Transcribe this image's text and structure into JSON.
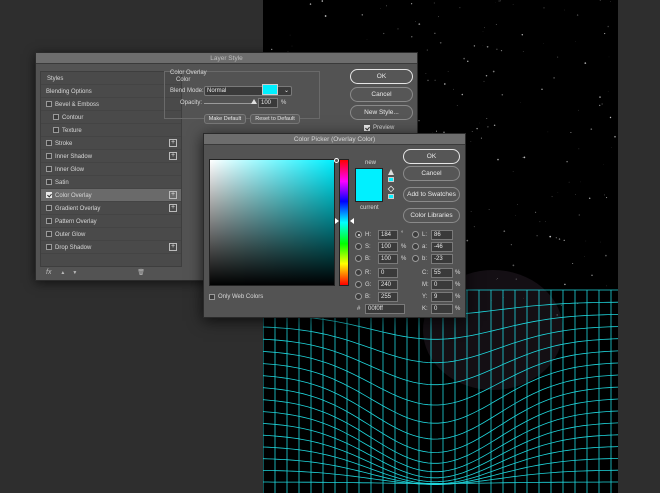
{
  "layer_style": {
    "title": "Layer Style",
    "styles_header": "Styles",
    "items": [
      {
        "label": "Blending Options",
        "checkbox": false,
        "checked": false,
        "indent": false,
        "plus": false,
        "selected": false
      },
      {
        "label": "Bevel & Emboss",
        "checkbox": true,
        "checked": false,
        "indent": false,
        "plus": false,
        "selected": false
      },
      {
        "label": "Contour",
        "checkbox": true,
        "checked": false,
        "indent": true,
        "plus": false,
        "selected": false
      },
      {
        "label": "Texture",
        "checkbox": true,
        "checked": false,
        "indent": true,
        "plus": false,
        "selected": false
      },
      {
        "label": "Stroke",
        "checkbox": true,
        "checked": false,
        "indent": false,
        "plus": true,
        "selected": false
      },
      {
        "label": "Inner Shadow",
        "checkbox": true,
        "checked": false,
        "indent": false,
        "plus": true,
        "selected": false
      },
      {
        "label": "Inner Glow",
        "checkbox": true,
        "checked": false,
        "indent": false,
        "plus": false,
        "selected": false
      },
      {
        "label": "Satin",
        "checkbox": true,
        "checked": false,
        "indent": false,
        "plus": false,
        "selected": false
      },
      {
        "label": "Color Overlay",
        "checkbox": true,
        "checked": true,
        "indent": false,
        "plus": true,
        "selected": true
      },
      {
        "label": "Gradient Overlay",
        "checkbox": true,
        "checked": false,
        "indent": false,
        "plus": true,
        "selected": false
      },
      {
        "label": "Pattern Overlay",
        "checkbox": true,
        "checked": false,
        "indent": false,
        "plus": false,
        "selected": false
      },
      {
        "label": "Outer Glow",
        "checkbox": true,
        "checked": false,
        "indent": false,
        "plus": false,
        "selected": false
      },
      {
        "label": "Drop Shadow",
        "checkbox": true,
        "checked": false,
        "indent": false,
        "plus": true,
        "selected": false
      }
    ],
    "plus_glyph": "+",
    "fx_label": "fx",
    "up_glyph": "▲",
    "down_glyph": "▼",
    "trash_glyph": "🗑",
    "panel_title": "Color Overlay",
    "panel_subtitle": "Color",
    "blend_mode_label": "Blend Mode:",
    "blend_mode_value": "Normal",
    "opacity_label": "Opacity:",
    "opacity_value": "100",
    "opacity_unit": "%",
    "opacity_level": 1.0,
    "make_default": "Make Default",
    "reset_default": "Reset to Default",
    "ok": "OK",
    "cancel": "Cancel",
    "new_style": "New Style...",
    "preview_label": "Preview",
    "preview_checked": true,
    "overlay_color": "#00f0ff"
  },
  "color_picker": {
    "title": "Color Picker (Overlay Color)",
    "new_label": "new",
    "current_label": "current",
    "ok": "OK",
    "cancel": "Cancel",
    "add_to_swatches": "Add to Swatches",
    "color_libraries": "Color Libraries",
    "only_web_colors": "Only Web Colors",
    "fields": {
      "h": {
        "label": "H:",
        "value": "184",
        "unit": "°"
      },
      "s": {
        "label": "S:",
        "value": "100",
        "unit": "%"
      },
      "b": {
        "label": "B:",
        "value": "100",
        "unit": "%"
      },
      "r": {
        "label": "R:",
        "value": "0",
        "unit": ""
      },
      "g": {
        "label": "G:",
        "value": "240",
        "unit": ""
      },
      "bb": {
        "label": "B:",
        "value": "255",
        "unit": ""
      },
      "l": {
        "label": "L:",
        "value": "86",
        "unit": ""
      },
      "a": {
        "label": "a:",
        "value": "-46",
        "unit": ""
      },
      "b2": {
        "label": "b:",
        "value": "-23",
        "unit": ""
      },
      "c": {
        "label": "C:",
        "value": "55",
        "unit": "%"
      },
      "m": {
        "label": "M:",
        "value": "0",
        "unit": "%"
      },
      "y": {
        "label": "Y:",
        "value": "9",
        "unit": "%"
      },
      "k": {
        "label": "K:",
        "value": "0",
        "unit": "%"
      }
    },
    "hex_label": "#",
    "hex_value": "00f0ff",
    "new_color": "#00f0ff",
    "current_color": "#00f0ff"
  }
}
